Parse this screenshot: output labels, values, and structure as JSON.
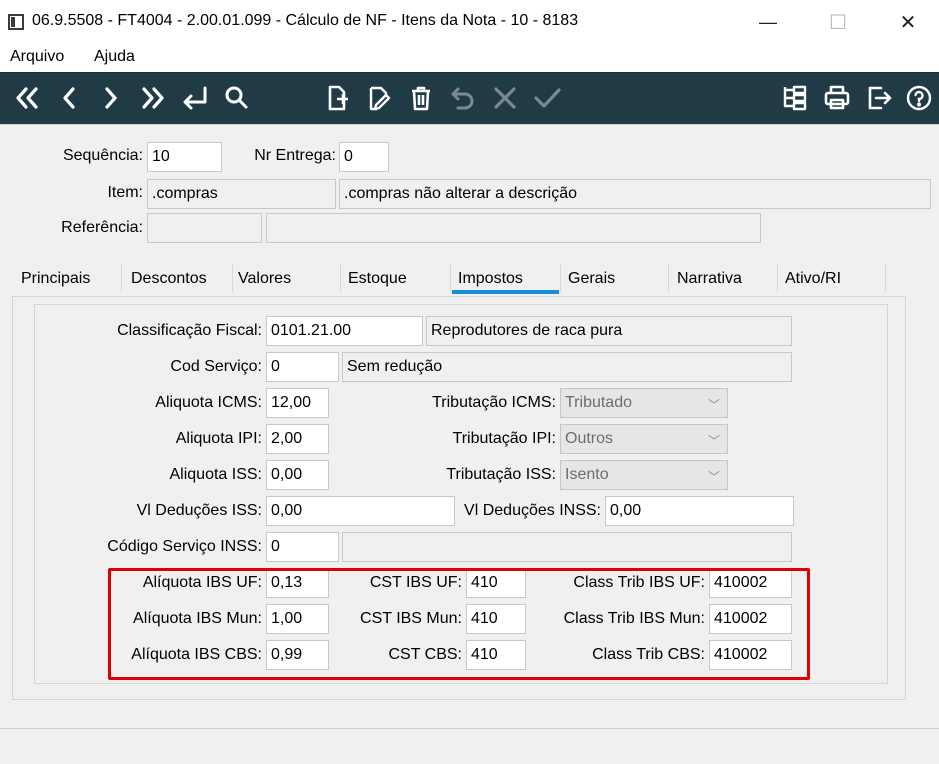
{
  "window": {
    "title": "06.9.5508 - FT4004 - 2.00.01.099 - Cálculo de NF - Itens da Nota - 10 - 8183",
    "minimize": "—",
    "maximize": "☐",
    "close": "✕"
  },
  "menu": {
    "items": [
      "Arquivo",
      "Ajuda"
    ]
  },
  "toolbar": {
    "icons": [
      "first-icon",
      "previous-icon",
      "next-icon",
      "last-icon",
      "return-icon",
      "search-icon",
      "new-icon",
      "edit-icon",
      "delete-icon",
      "undo-icon",
      "cancel-icon",
      "confirm-icon",
      "tree-icon",
      "print-icon",
      "exit-icon",
      "help-icon"
    ]
  },
  "header": {
    "sequencia_label": "Sequência:",
    "sequencia_value": "10",
    "nr_entrega_label": "Nr Entrega:",
    "nr_entrega_value": "0",
    "item_label": "Item:",
    "item_code": ".compras",
    "item_desc": ".compras não alterar a descrição",
    "referencia_label": "Referência:",
    "referencia_value": "",
    "referencia_desc": ""
  },
  "tabs": [
    "Principais",
    "Descontos",
    "Valores",
    "Estoque",
    "Impostos",
    "Gerais",
    "Narrativa",
    "Ativo/RI"
  ],
  "active_tab": "Impostos",
  "impostos": {
    "class_fiscal_label": "Classificação Fiscal:",
    "class_fiscal_code": "0101.21.00",
    "class_fiscal_desc": "Reprodutores de raca pura",
    "cod_servico_label": "Cod Serviço:",
    "cod_servico_code": "0",
    "cod_servico_desc": "Sem redução",
    "aliq_icms_label": "Aliquota ICMS:",
    "aliq_icms_value": "12,00",
    "trib_icms_label": "Tributação ICMS:",
    "trib_icms_value": "Tributado",
    "aliq_ipi_label": "Aliquota IPI:",
    "aliq_ipi_value": "2,00",
    "trib_ipi_label": "Tributação IPI:",
    "trib_ipi_value": "Outros",
    "aliq_iss_label": "Aliquota ISS:",
    "aliq_iss_value": "0,00",
    "trib_iss_label": "Tributação ISS:",
    "trib_iss_value": "Isento",
    "vl_ded_iss_label": "Vl Deduções ISS:",
    "vl_ded_iss_value": "0,00",
    "vl_ded_inss_label": "Vl Deduções INSS:",
    "vl_ded_inss_value": "0,00",
    "cod_serv_inss_label": "Código Serviço INSS:",
    "cod_serv_inss_code": "0",
    "cod_serv_inss_desc": "",
    "aliq_ibs_uf_label": "Alíquota IBS UF:",
    "aliq_ibs_uf_value": "0,13",
    "cst_ibs_uf_label": "CST IBS UF:",
    "cst_ibs_uf_value": "410",
    "class_trib_ibs_uf_label": "Class Trib IBS UF:",
    "class_trib_ibs_uf_value": "410002",
    "aliq_ibs_mun_label": "Alíquota IBS Mun:",
    "aliq_ibs_mun_value": "1,00",
    "cst_ibs_mun_label": "CST IBS Mun:",
    "cst_ibs_mun_value": "410",
    "class_trib_ibs_mun_label": "Class Trib IBS Mun:",
    "class_trib_ibs_mun_value": "410002",
    "aliq_ibs_cbs_label": "Alíquota IBS CBS:",
    "aliq_ibs_cbs_value": "0,99",
    "cst_cbs_label": "CST CBS:",
    "cst_cbs_value": "410",
    "class_trib_cbs_label": "Class Trib CBS:",
    "class_trib_cbs_value": "410002"
  },
  "colors": {
    "toolbar_bg": "#203a46",
    "tab_accent": "#1590d6",
    "highlight": "#e00000"
  }
}
